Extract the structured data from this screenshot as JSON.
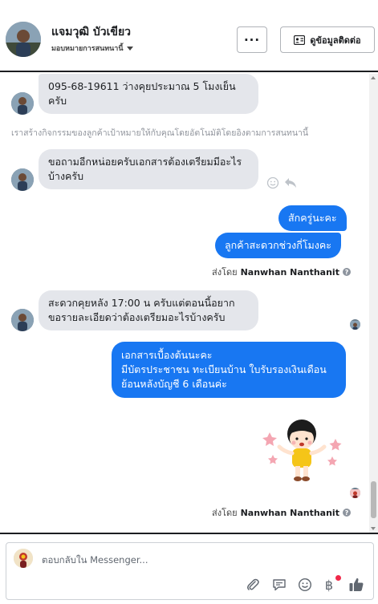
{
  "header": {
    "name": "แจมวุฒิ บัวเขียว",
    "assign_label": "มอบหมายการสนทนานี้",
    "more_label": "···",
    "contact_label": "ดูข้อมูลติดต่อ"
  },
  "messages": {
    "m1_text": "095-68-19611 ว่างคุยประมาณ 5 โมงเย็นครับ",
    "system_note": "เราสร้างกิจกรรมของลูกค้าเป้าหมายให้กับคุณโดยอัตโนมัติโดยอิงตามการสนทนานี้",
    "m2_text": "ขอถามอีกหน่อยครับเอกสารต้องเตรียมมีอะไรบ้างครับ",
    "m3_text": "สักครู่นะคะ",
    "m4_text": "ลูกค้าสะดวกช่วงกี่โมงคะ",
    "sent_by_1_prefix": "ส่งโดย",
    "sent_by_1_name": "Nanwhan Nanthanit",
    "m5_text": "สะดวกคุยหลัง 17:00 น ครับแต่ตอนนี้อยาก ขอรายละเอียดว่าต้องเตรียมอะไรบ้างครับ",
    "m6_line1": "เอกสารเบื้องต้นนะคะ",
    "m6_line2": "มีบัตรประชาชน ทะเบียนบ้าน ใบรับรองเงินเดือน",
    "m6_line3": "ย้อนหลังบัญชี 6 เดือนค่ะ",
    "sent_by_2_prefix": "ส่งโดย",
    "sent_by_2_name": "Nanwhan Nanthanit"
  },
  "composer": {
    "placeholder": "ตอบกลับใน Messenger..."
  },
  "icons": {
    "header_more": "more-icon",
    "contact": "contact-card-icon",
    "emoji_react": "smiley-icon",
    "reply": "reply-icon",
    "attach": "paperclip-icon",
    "quick_reply": "chat-bubble-icon",
    "emoji": "smiley-icon",
    "payment": "baht-icon",
    "like": "thumbs-up-icon"
  },
  "colors": {
    "outgoing": "#1877f2",
    "incoming": "#e4e6eb",
    "notification": "#f02849"
  }
}
